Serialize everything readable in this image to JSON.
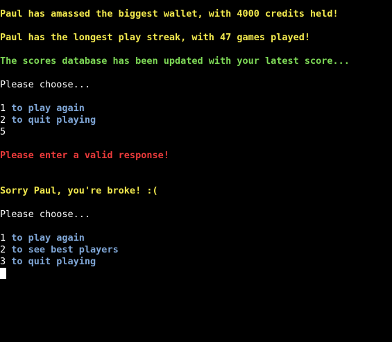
{
  "colors": {
    "background": "#000000",
    "yellow": "#f2e94e",
    "green": "#7ed957",
    "red": "#ec3b3b",
    "white": "#ffffff",
    "option_blue": "#7fa6d6"
  },
  "messages": {
    "wallet": "Paul has amassed the biggest wallet, with 4000 credits held!",
    "streak": "Paul has the longest play streak, with 47 games played!",
    "db_updated": "The scores database has been updated with your latest score...",
    "invalid": "Please enter a valid response!",
    "broke": "Sorry Paul, you're broke! :("
  },
  "menu1": {
    "prompt": "Please choose...",
    "options": [
      {
        "number": "1",
        "text": " to play again"
      },
      {
        "number": "2",
        "text": " to quit playing"
      }
    ],
    "user_input": "5"
  },
  "menu2": {
    "prompt": "Please choose...",
    "options": [
      {
        "number": "1",
        "text": " to play again"
      },
      {
        "number": "2",
        "text": " to see best players"
      },
      {
        "number": "3",
        "text": " to quit playing"
      }
    ]
  },
  "icons": {
    "cursor": "block-cursor-icon"
  }
}
